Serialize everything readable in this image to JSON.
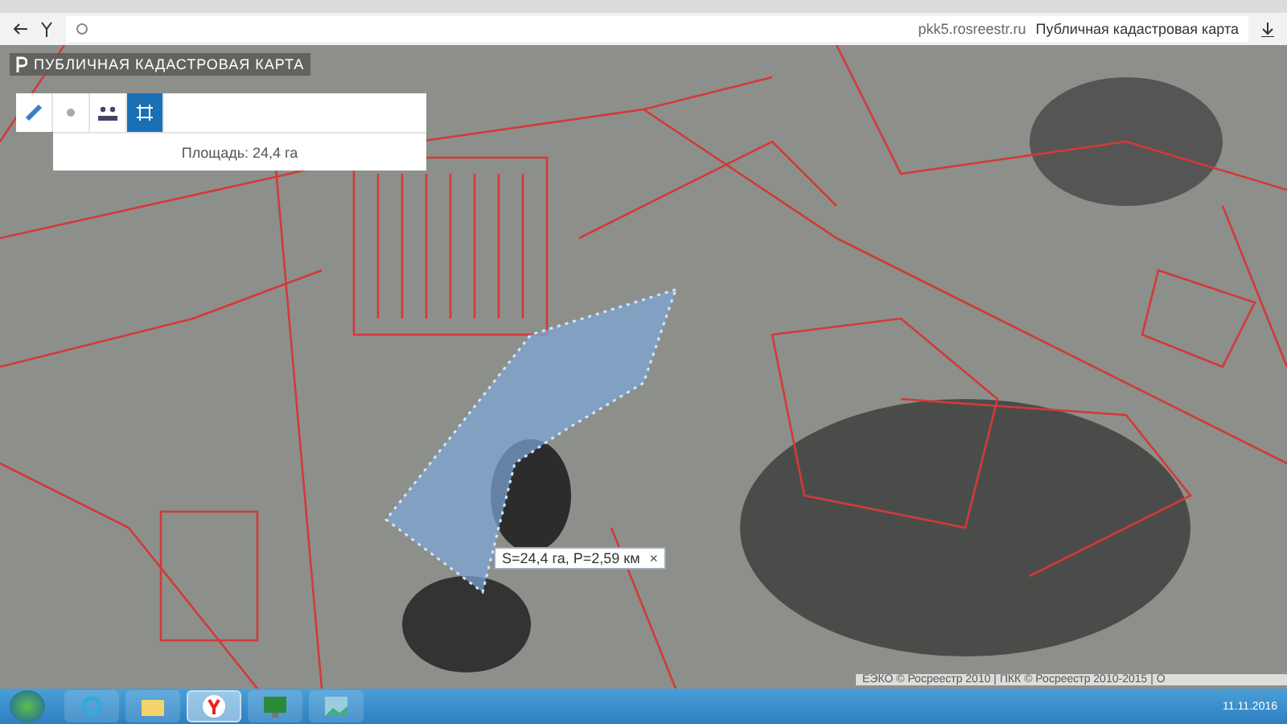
{
  "browser": {
    "url": "pkk5.rosreestr.ru",
    "page_title": "Публичная кадастровая карта"
  },
  "map": {
    "title": "ПУБЛИЧНАЯ КАДАСТРОВАЯ КАРТА",
    "tools": [
      {
        "kind": "ruler",
        "selected": false
      },
      {
        "kind": "point",
        "selected": false
      },
      {
        "kind": "people",
        "selected": false
      },
      {
        "kind": "area",
        "selected": true
      }
    ],
    "area_result": "Площадь: 24,4 га",
    "measurement": {
      "text": "S=24,4 га, P=2,59 км",
      "close": "×"
    },
    "attribution": "ЕЭКО © Росреестр 2010 | ПКК © Росреестр 2010-2015 | О"
  },
  "taskbar": {
    "apps": [
      {
        "kind": "ie",
        "selected": false
      },
      {
        "kind": "folder",
        "selected": false
      },
      {
        "kind": "yandex",
        "selected": true
      },
      {
        "kind": "monitor",
        "selected": false
      },
      {
        "kind": "photo",
        "selected": false
      }
    ],
    "date": "11.11.2016"
  }
}
